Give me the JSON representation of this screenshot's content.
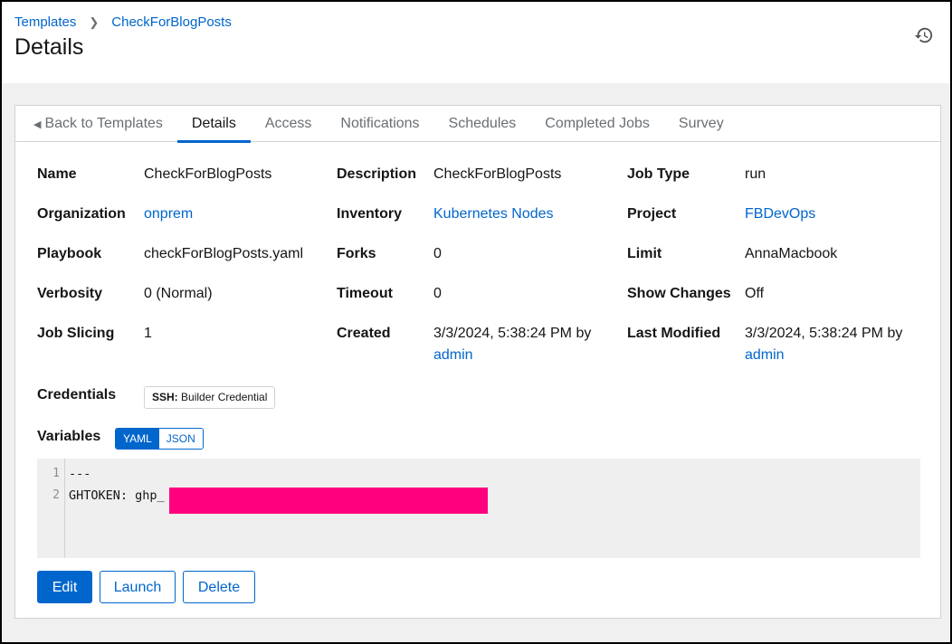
{
  "breadcrumb": {
    "templates": "Templates",
    "current": "CheckForBlogPosts"
  },
  "page_title": "Details",
  "tabs": [
    {
      "label": "Back to Templates"
    },
    {
      "label": "Details"
    },
    {
      "label": "Access"
    },
    {
      "label": "Notifications"
    },
    {
      "label": "Schedules"
    },
    {
      "label": "Completed Jobs"
    },
    {
      "label": "Survey"
    }
  ],
  "fields": {
    "name": {
      "label": "Name",
      "value": "CheckForBlogPosts"
    },
    "description": {
      "label": "Description",
      "value": "CheckForBlogPosts"
    },
    "job_type": {
      "label": "Job Type",
      "value": "run"
    },
    "organization": {
      "label": "Organization",
      "value": "onprem"
    },
    "inventory": {
      "label": "Inventory",
      "value": "Kubernetes Nodes"
    },
    "project": {
      "label": "Project",
      "value": "FBDevOps"
    },
    "playbook": {
      "label": "Playbook",
      "value": "checkForBlogPosts.yaml"
    },
    "forks": {
      "label": "Forks",
      "value": "0"
    },
    "limit": {
      "label": "Limit",
      "value": "AnnaMacbook"
    },
    "verbosity": {
      "label": "Verbosity",
      "value": "0 (Normal)"
    },
    "timeout": {
      "label": "Timeout",
      "value": "0"
    },
    "show_changes": {
      "label": "Show Changes",
      "value": "Off"
    },
    "job_slicing": {
      "label": "Job Slicing",
      "value": "1"
    },
    "created": {
      "label": "Created",
      "value": "3/3/2024, 5:38:24 PM by",
      "user": "admin"
    },
    "last_modified": {
      "label": "Last Modified",
      "value": "3/3/2024, 5:38:24 PM by",
      "user": "admin"
    },
    "credentials": {
      "label": "Credentials",
      "chip_type": "SSH:",
      "chip_name": "Builder Credential"
    },
    "variables": {
      "label": "Variables",
      "yaml": "YAML",
      "json": "JSON"
    }
  },
  "editor": {
    "lines": [
      {
        "num": "1",
        "text": "---"
      },
      {
        "num": "2",
        "text": "GHTOKEN: ghp_"
      }
    ],
    "redaction_color": "#ff007f"
  },
  "buttons": {
    "edit": "Edit",
    "launch": "Launch",
    "delete": "Delete"
  },
  "colors": {
    "accent": "#0066cc",
    "text": "#151515",
    "muted": "#6a6e73"
  },
  "icons": {
    "history": "history-icon",
    "back": "caret-left-icon",
    "breadcrumb_sep": "chevron-right-icon"
  }
}
